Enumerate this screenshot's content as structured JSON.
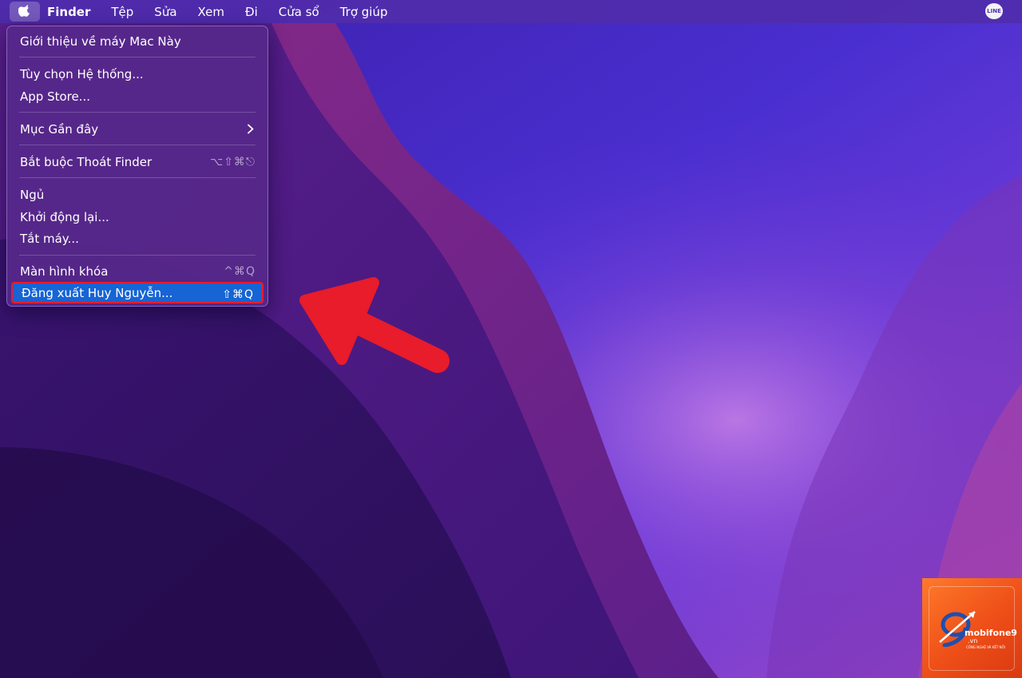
{
  "menubar": {
    "app_name": "Finder",
    "items": [
      "Tệp",
      "Sửa",
      "Xem",
      "Đi",
      "Cửa sổ",
      "Trợ giúp"
    ],
    "line_icon_label": "LINE"
  },
  "apple_menu": {
    "items": [
      {
        "label": "Giới thiệu về máy Mac Này",
        "shortcut": ""
      },
      {
        "label": "Tùy chọn Hệ thống...",
        "shortcut": ""
      },
      {
        "label": "App Store...",
        "shortcut": ""
      },
      {
        "label": "Mục Gần đây",
        "shortcut": ""
      },
      {
        "label": "Bắt buộc Thoát Finder",
        "shortcut": "⌥⇧⌘⎋"
      },
      {
        "label": "Ngủ",
        "shortcut": ""
      },
      {
        "label": "Khởi động lại...",
        "shortcut": ""
      },
      {
        "label": "Tắt máy...",
        "shortcut": ""
      },
      {
        "label": "Màn hình khóa",
        "shortcut": "^⌘Q"
      },
      {
        "label": "Đăng xuất Huy Nguyễn...",
        "shortcut": "⇧⌘Q"
      }
    ],
    "highlighted_index": 9
  },
  "logo": {
    "name": "mobifone9",
    "domain": ".vn",
    "tagline": "CÔNG NGHỆ VÀ KẾT NỐI"
  },
  "colors": {
    "highlight": "#1764d4",
    "annotation_red": "#e81c2a",
    "menubar": "#502daa"
  }
}
